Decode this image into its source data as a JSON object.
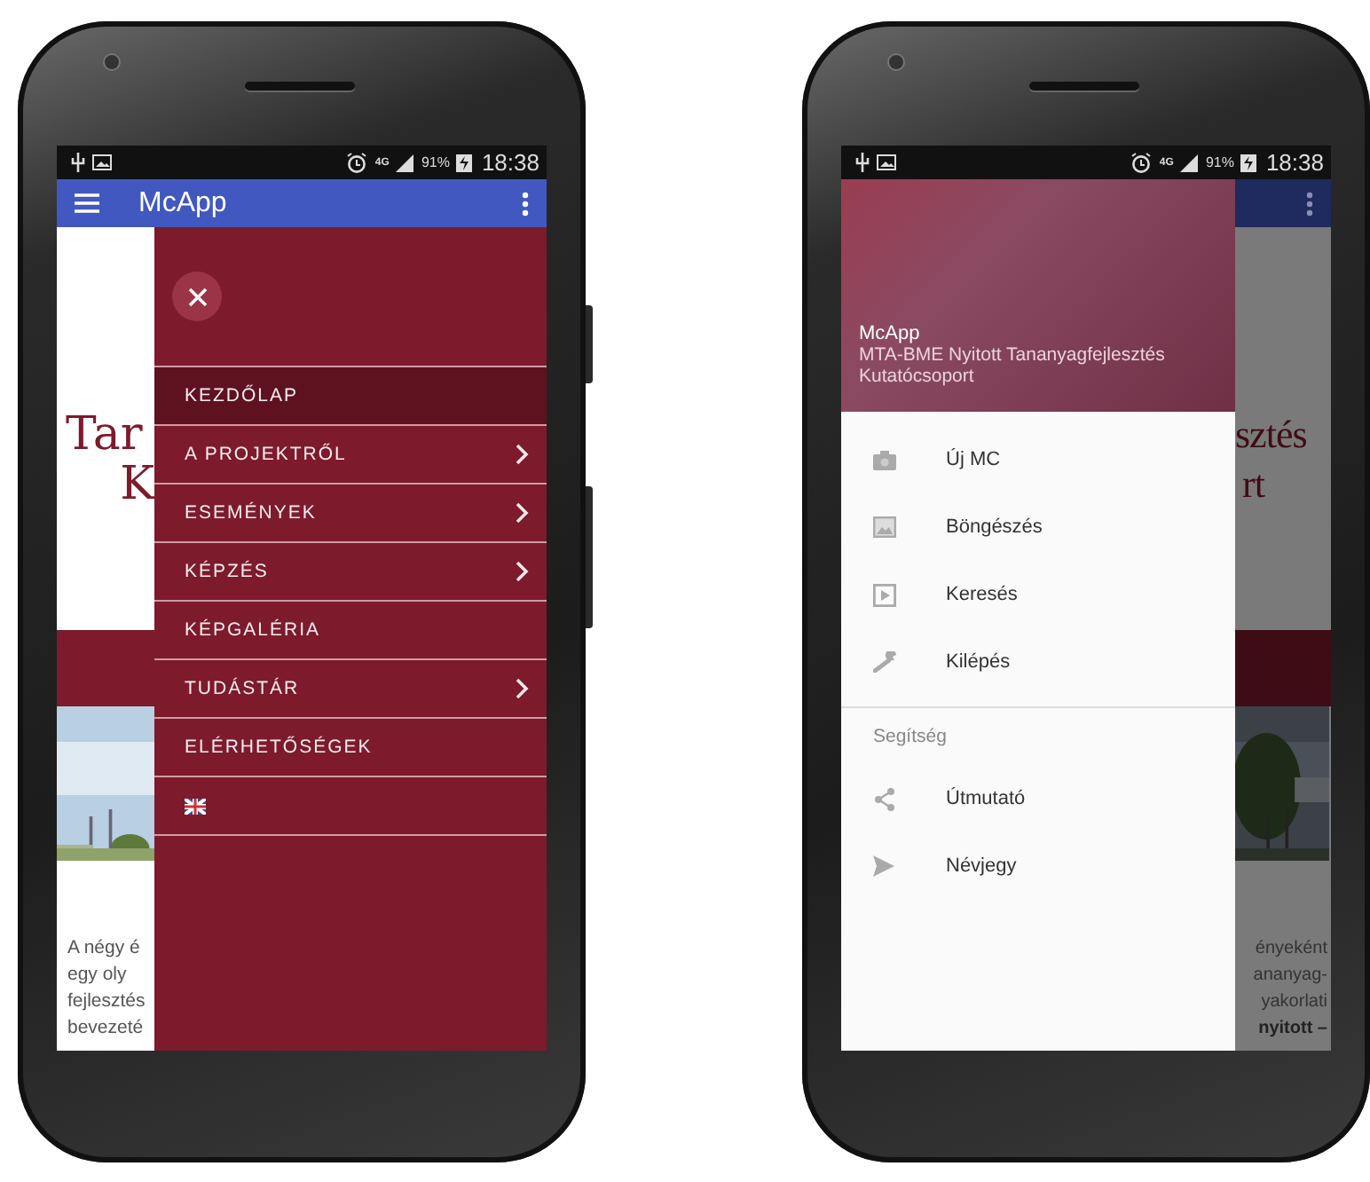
{
  "left_phone": {
    "status_bar": {
      "network": "4G",
      "battery": "91%",
      "time": "18:38"
    },
    "app_bar": {
      "title": "McApp"
    },
    "page": {
      "heading_lines": [
        "Tar",
        "K"
      ],
      "text_lines": [
        {
          "text": "A négy é",
          "bold": false
        },
        {
          "text": "egy oly",
          "bold": false
        },
        {
          "text": "fejlesztés",
          "bold": false
        },
        {
          "text": "bevezeté",
          "bold": false
        }
      ]
    },
    "menu": {
      "items": [
        {
          "kind": "link",
          "label": "KEZDŐLAP",
          "selected": true,
          "has_submenu": false
        },
        {
          "kind": "link",
          "label": "A PROJEKTRŐL",
          "selected": false,
          "has_submenu": true
        },
        {
          "kind": "link",
          "label": "ESEMÉNYEK",
          "selected": false,
          "has_submenu": true
        },
        {
          "kind": "link",
          "label": "KÉPZÉS",
          "selected": false,
          "has_submenu": true
        },
        {
          "kind": "link",
          "label": "KÉPGALÉRIA",
          "selected": false,
          "has_submenu": false
        },
        {
          "kind": "link",
          "label": "TUDÁSTÁR",
          "selected": false,
          "has_submenu": true
        },
        {
          "kind": "link",
          "label": "ELÉRHETŐSÉGEK",
          "selected": false,
          "has_submenu": false
        },
        {
          "kind": "flag",
          "selected": false,
          "has_submenu": false
        }
      ]
    }
  },
  "right_phone": {
    "status_bar": {
      "network": "4G",
      "battery": "91%",
      "time": "18:38"
    },
    "drawer": {
      "title": "McApp",
      "subtitle": "MTA-BME Nyitott Tananyagfejlesztés Kutatócsoport",
      "items": [
        {
          "label": "Új MC",
          "selected": false
        },
        {
          "label": "Böngészés",
          "selected": false
        },
        {
          "label": "Keresés",
          "selected": false
        },
        {
          "label": "Kilépés",
          "selected": false
        }
      ],
      "section_title": "Segítség",
      "section_items": [
        {
          "label": "Útmutató",
          "selected": false
        },
        {
          "label": "Névjegy",
          "selected": false
        }
      ]
    },
    "page": {
      "heading_lines": [
        "sztés",
        "rt"
      ],
      "text_lines": [
        {
          "text": "ényeként",
          "bold": false
        },
        {
          "text": "ananyag-",
          "bold": false
        },
        {
          "text": "yakorlati",
          "bold": false
        },
        {
          "text": "nyitott –",
          "bold": true
        }
      ]
    }
  }
}
